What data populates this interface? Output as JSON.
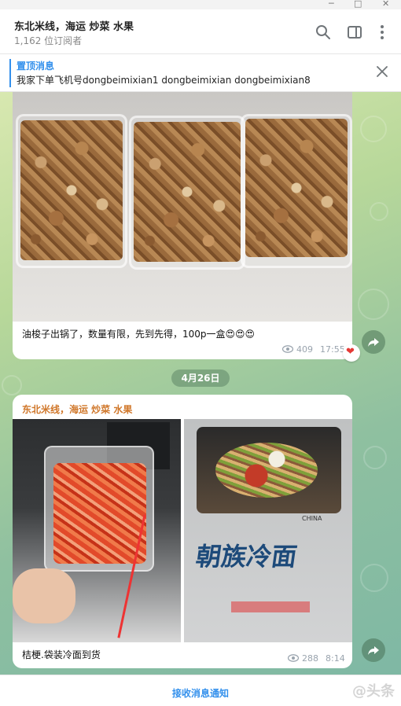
{
  "channel": {
    "title": "东北米线，海运 炒菜 水果",
    "subscribers": "1,162 位订阅者"
  },
  "pinned": {
    "label": "置顶消息",
    "text": "我家下单飞机号dongbeimixian1      dongbeimixian      dongbeimixian8"
  },
  "messages": [
    {
      "caption": "油梭子出锅了，数量有限，先到先得，100p一盒😍😍😍",
      "views": "409",
      "time": "17:55",
      "reaction": "❤"
    },
    {
      "author": "东北米线，海运 炒菜 水果",
      "caption": "桔梗.袋装冷面到货",
      "views": "288",
      "time": "8:14",
      "package_text": "朝族冷面",
      "package_sub": "CHINA"
    }
  ],
  "date_separator": "4月26日",
  "footer": {
    "notify_label": "接收消息通知",
    "watermark": "@头条"
  },
  "icons": [
    "minimize-icon",
    "maximize-icon",
    "close-window-icon",
    "search-icon",
    "sidebar-toggle-icon",
    "more-icon",
    "close-icon",
    "eye-icon",
    "share-icon",
    "heart-icon"
  ]
}
